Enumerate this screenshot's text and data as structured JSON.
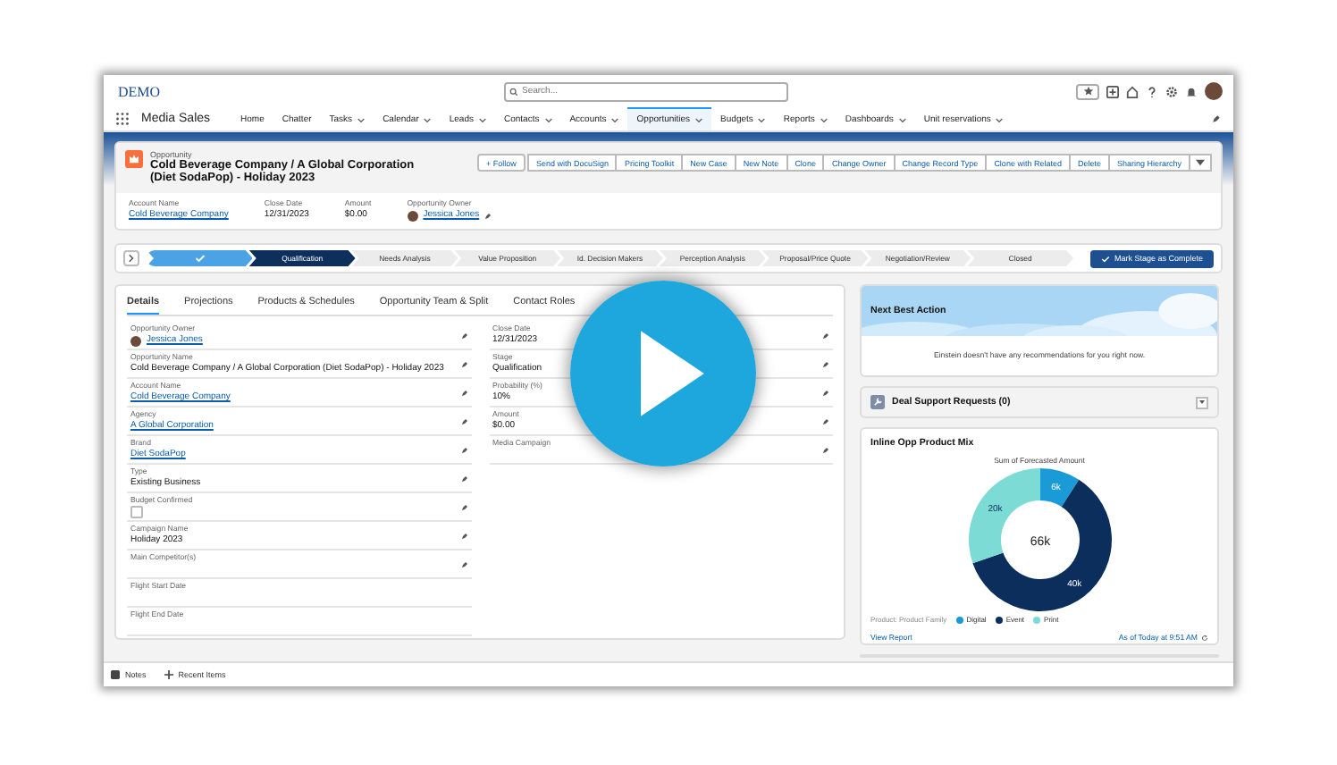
{
  "header": {
    "logo": "DEMO",
    "search": {
      "placeholder": "Search..."
    }
  },
  "app_name": "Media Sales",
  "nav": [
    {
      "label": "Home",
      "dropdown": false,
      "selected": false
    },
    {
      "label": "Chatter",
      "dropdown": false,
      "selected": false
    },
    {
      "label": "Tasks",
      "dropdown": true,
      "selected": false
    },
    {
      "label": "Calendar",
      "dropdown": true,
      "selected": false
    },
    {
      "label": "Leads",
      "dropdown": true,
      "selected": false
    },
    {
      "label": "Contacts",
      "dropdown": true,
      "selected": false
    },
    {
      "label": "Accounts",
      "dropdown": true,
      "selected": false
    },
    {
      "label": "Opportunities",
      "dropdown": true,
      "selected": true
    },
    {
      "label": "Budgets",
      "dropdown": true,
      "selected": false
    },
    {
      "label": "Reports",
      "dropdown": true,
      "selected": false
    },
    {
      "label": "Dashboards",
      "dropdown": true,
      "selected": false
    },
    {
      "label": "Unit reservations",
      "dropdown": true,
      "selected": false
    }
  ],
  "record": {
    "type": "Opportunity",
    "title": "Cold Beverage Company / A Global Corporation (Diet SodaPop) - Holiday 2023",
    "follow": "+ Follow",
    "actions": [
      "Send with DocuSign",
      "Pricing Toolkit",
      "New Case",
      "New Note",
      "Clone",
      "Change Owner",
      "Change Record Type",
      "Clone with Related",
      "Delete",
      "Sharing Hierarchy"
    ],
    "highlights": [
      {
        "label": "Account Name",
        "value": "Cold Beverage Company",
        "kind": "link"
      },
      {
        "label": "Close Date",
        "value": "12/31/2023",
        "kind": "text"
      },
      {
        "label": "Amount",
        "value": "$0.00",
        "kind": "text"
      },
      {
        "label": "Opportunity Owner",
        "value": "Jessica Jones",
        "kind": "user"
      }
    ]
  },
  "path": {
    "stages": [
      {
        "completed": true,
        "selected": false
      },
      {
        "label": "Qualification",
        "completed": false,
        "selected": true
      },
      {
        "label": "Needs Analysis",
        "completed": false,
        "selected": false
      },
      {
        "label": "Value Proposition",
        "completed": false,
        "selected": false
      },
      {
        "label": "Id. Decision Makers",
        "completed": false,
        "selected": false
      },
      {
        "label": "Perception Analysis",
        "completed": false,
        "selected": false
      },
      {
        "label": "Proposal/Price Quote",
        "completed": false,
        "selected": false
      },
      {
        "label": "Negotiation/Review",
        "completed": false,
        "selected": false
      },
      {
        "label": "Closed",
        "completed": false,
        "selected": false
      }
    ],
    "button": "Mark Stage as Complete"
  },
  "tabs": [
    {
      "label": "Details",
      "selected": true
    },
    {
      "label": "Projections",
      "selected": false
    },
    {
      "label": "Products & Schedules",
      "selected": false
    },
    {
      "label": "Opportunity Team & Split",
      "selected": false
    },
    {
      "label": "Contact Roles",
      "selected": false
    }
  ],
  "left_fields": [
    {
      "label": "Opportunity Owner",
      "value": "Jessica Jones",
      "kind": "user",
      "editable": true
    },
    {
      "label": "Opportunity Name",
      "value": "Cold Beverage Company / A Global Corporation (Diet SodaPop) - Holiday 2023",
      "kind": "text",
      "editable": true
    },
    {
      "label": "Account Name",
      "value": "Cold Beverage Company",
      "kind": "link",
      "editable": true
    },
    {
      "label": "Agency",
      "value": "A Global Corporation",
      "kind": "link",
      "editable": true
    },
    {
      "label": "Brand",
      "value": "Diet SodaPop",
      "kind": "link",
      "editable": true
    },
    {
      "label": "Type",
      "value": "Existing Business",
      "kind": "text",
      "editable": true
    },
    {
      "label": "Budget Confirmed",
      "kind": "checkbox",
      "checked": false,
      "editable": true
    },
    {
      "label": "Campaign Name",
      "value": "Holiday 2023",
      "kind": "text",
      "editable": true
    },
    {
      "label": "Main Competitor(s)",
      "editable": true
    },
    {
      "label": "Flight Start Date",
      "editable": false
    },
    {
      "label": "Flight End Date",
      "editable": false
    }
  ],
  "right_fields": [
    {
      "label": "Close Date",
      "value": "12/31/2023",
      "kind": "text",
      "editable": true
    },
    {
      "label": "Stage",
      "value": "Qualification",
      "kind": "text",
      "editable": true
    },
    {
      "label": "Probability (%)",
      "value": "10%",
      "kind": "text",
      "editable": true
    },
    {
      "label": "Amount",
      "value": "$0.00",
      "kind": "text",
      "editable": true
    },
    {
      "label": "Media Campaign",
      "editable": true
    }
  ],
  "next_best_action": {
    "title": "Next Best Action",
    "message": "Einstein doesn't have any recommendations for you right now."
  },
  "deal_support": {
    "title": "Deal Support Requests (0)"
  },
  "product_mix": {
    "title": "Inline Opp Product Mix",
    "center_label": "66k",
    "legend_title": "Product: Product Family",
    "link": "View Report",
    "timestamp": "As of Today at 9:51 AM",
    "chart_data": {
      "type": "donut",
      "title": "Sum of Forecasted Amount",
      "categories": [
        "Digital",
        "Event",
        "Print"
      ],
      "series": [
        {
          "colors": [
            "#1b9ad8",
            "#0c2e5c",
            "#7ddbd5"
          ],
          "values": [
            9.1,
            60.6,
            30.3
          ]
        }
      ],
      "value_labels": [
        "6k",
        "40k",
        "20k"
      ]
    }
  },
  "footer": [
    "Notes",
    "Recent Items"
  ],
  "play_button": true
}
